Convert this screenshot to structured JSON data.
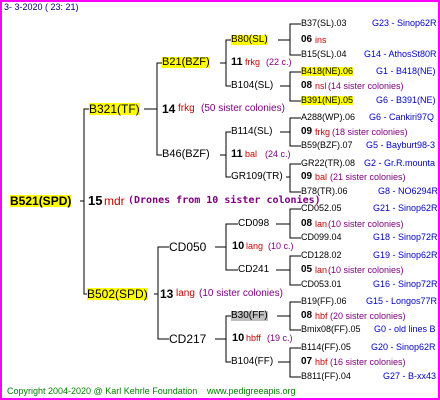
{
  "header": {
    "date": "3-  3-2020 ( 23: 21)"
  },
  "root": {
    "label": "B521(SPD)",
    "num": "15",
    "country": "mdr",
    "note": "(Drones from 10 sister colonies)"
  },
  "gen1": [
    {
      "label": "B321(TF)",
      "num": "14",
      "country": "frkg",
      "note": "(50 sister colonies)"
    },
    {
      "label": "B502(SPD)",
      "num": "13",
      "country": "lang",
      "note": "(10 sister colonies)"
    }
  ],
  "gen2": [
    {
      "label": "B21(BZF)",
      "num": "11",
      "country": "frkg",
      "note": "(22 c.)"
    },
    {
      "label": "B46(BZF)",
      "num": "11",
      "country": "bal",
      "note": "(24 c.)"
    },
    {
      "label": "CD050",
      "num": "10",
      "country": "lang",
      "note": "(10 c.)"
    },
    {
      "label": "CD217",
      "num": "10",
      "country": "hbff",
      "note": "(19 c.)"
    }
  ],
  "gen3": [
    {
      "label": "B80(SL)",
      "num": "06",
      "country": "ins",
      "note": ""
    },
    {
      "label": "B104(SL)",
      "num": "08",
      "country": "nsl",
      "note": "(14 sister colonies)"
    },
    {
      "label": "B114(SL)",
      "num": "09",
      "country": "frkg",
      "note": "(18 sister colonies)"
    },
    {
      "label": "GR109(TR)",
      "num": "09",
      "country": "bal",
      "note": "(21 sister colonies)"
    },
    {
      "label": "CD098",
      "num": "08",
      "country": "lan",
      "note": "(10 sister colonies)"
    },
    {
      "label": "CD241",
      "num": "05",
      "country": "lan",
      "note": "(10 sister colonies)"
    },
    {
      "label": "B30(FF)",
      "num": "08",
      "country": "hbf",
      "note": "(20 sister colonies)"
    },
    {
      "label": "B104(FF)",
      "num": "07",
      "country": "hbf",
      "note": "(16 sister colonies)"
    }
  ],
  "gen4": [
    {
      "label": "B37(SL).03",
      "ref": "G23 - Sinop62R"
    },
    {
      "label": "B15(SL).04",
      "ref": "G14 - AthosSt80R"
    },
    {
      "label": "B418(NE).06",
      "ref": "G1 - B418(NE)"
    },
    {
      "label": "B391(NE).05",
      "ref": "G6 - B391(NE)"
    },
    {
      "label": "A288(WP).06",
      "ref": "G6 - Cankiri97Q"
    },
    {
      "label": "B59(BZF).07",
      "ref": "G5 - Bayburt98-3"
    },
    {
      "label": "GR22(TR).08",
      "ref": "G2 - Gr.R.mounta"
    },
    {
      "label": "B78(TR).06",
      "ref": "G8 - NO6294R"
    },
    {
      "label": "CD052.05",
      "ref": "G21 - Sinop62R"
    },
    {
      "label": "CD099.04",
      "ref": "G18 - Sinop72R"
    },
    {
      "label": "CD128.02",
      "ref": "G19 - Sinop62R"
    },
    {
      "label": "CD053.01",
      "ref": "G16 - Sinop72R"
    },
    {
      "label": "B19(FF).06",
      "ref": "G15 - Longos77R"
    },
    {
      "label": "Bmix08(FF).05",
      "ref": "G0 - old lines B"
    },
    {
      "label": "B114(FF).05",
      "ref": "G20 - Sinop62R"
    },
    {
      "label": "B811(FF).04",
      "ref": "G27 - B-xx43"
    }
  ],
  "footer": {
    "copyright": "Copyright 2004-2020 @ Karl Kehrle Foundation",
    "site": "www.pedigreeapis.org"
  }
}
